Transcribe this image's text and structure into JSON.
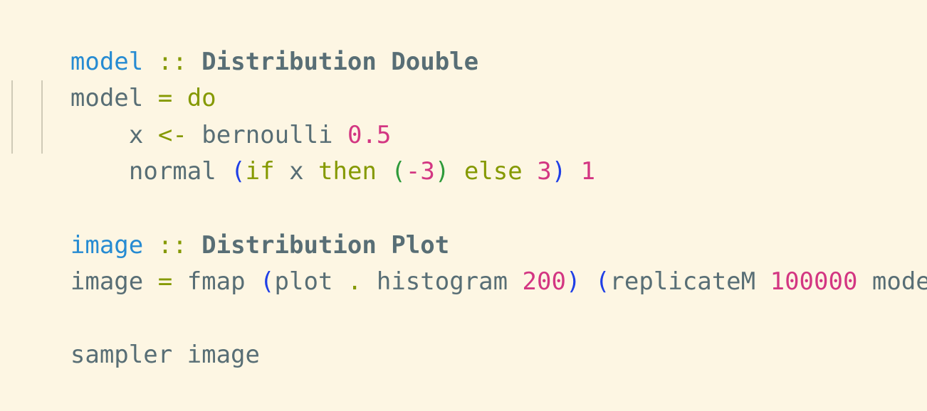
{
  "editor": {
    "background": "#fdf6e3",
    "colors": {
      "definition": "#268bd2",
      "keyword": "#859900",
      "identifier": "#586e75",
      "number": "#d33682",
      "paren_outer": "#1f3fe6",
      "paren_inner": "#2e9a3a"
    },
    "lines": [
      [
        {
          "text": "model",
          "role": "def"
        },
        {
          "text": " ",
          "role": "id"
        },
        {
          "text": "::",
          "role": "op"
        },
        {
          "text": " ",
          "role": "id"
        },
        {
          "text": "Distribution Double",
          "role": "type"
        }
      ],
      [
        {
          "text": "model",
          "role": "id"
        },
        {
          "text": " ",
          "role": "id"
        },
        {
          "text": "=",
          "role": "op"
        },
        {
          "text": " ",
          "role": "id"
        },
        {
          "text": "do",
          "role": "kw"
        }
      ],
      [
        {
          "text": "x",
          "role": "id"
        },
        {
          "text": " ",
          "role": "id"
        },
        {
          "text": "<-",
          "role": "op"
        },
        {
          "text": " bernoulli ",
          "role": "id"
        },
        {
          "text": "0.5",
          "role": "num"
        }
      ],
      [
        {
          "text": "normal ",
          "role": "id"
        },
        {
          "text": "(",
          "role": "p1"
        },
        {
          "text": "if",
          "role": "kw"
        },
        {
          "text": " x ",
          "role": "id"
        },
        {
          "text": "then",
          "role": "kw"
        },
        {
          "text": " ",
          "role": "id"
        },
        {
          "text": "(",
          "role": "p2"
        },
        {
          "text": "-3",
          "role": "num"
        },
        {
          "text": ")",
          "role": "p2"
        },
        {
          "text": " ",
          "role": "id"
        },
        {
          "text": "else",
          "role": "kw"
        },
        {
          "text": " ",
          "role": "id"
        },
        {
          "text": "3",
          "role": "num"
        },
        {
          "text": ")",
          "role": "p1"
        },
        {
          "text": " ",
          "role": "id"
        },
        {
          "text": "1",
          "role": "num"
        }
      ],
      [],
      [
        {
          "text": "image",
          "role": "def"
        },
        {
          "text": " ",
          "role": "id"
        },
        {
          "text": "::",
          "role": "op"
        },
        {
          "text": " ",
          "role": "id"
        },
        {
          "text": "Distribution Plot",
          "role": "type"
        }
      ],
      [
        {
          "text": "image",
          "role": "id"
        },
        {
          "text": " ",
          "role": "id"
        },
        {
          "text": "=",
          "role": "op"
        },
        {
          "text": " fmap ",
          "role": "id"
        },
        {
          "text": "(",
          "role": "p1"
        },
        {
          "text": "plot ",
          "role": "id"
        },
        {
          "text": ".",
          "role": "op"
        },
        {
          "text": " histogram ",
          "role": "id"
        },
        {
          "text": "200",
          "role": "num"
        },
        {
          "text": ")",
          "role": "p1"
        },
        {
          "text": " ",
          "role": "id"
        },
        {
          "text": "(",
          "role": "p1"
        },
        {
          "text": "replicateM ",
          "role": "id"
        },
        {
          "text": "100000",
          "role": "num"
        },
        {
          "text": " model",
          "role": "id"
        },
        {
          "text": ")",
          "role": "p1"
        }
      ],
      [],
      [
        {
          "text": "sampler image",
          "role": "id"
        }
      ]
    ]
  }
}
